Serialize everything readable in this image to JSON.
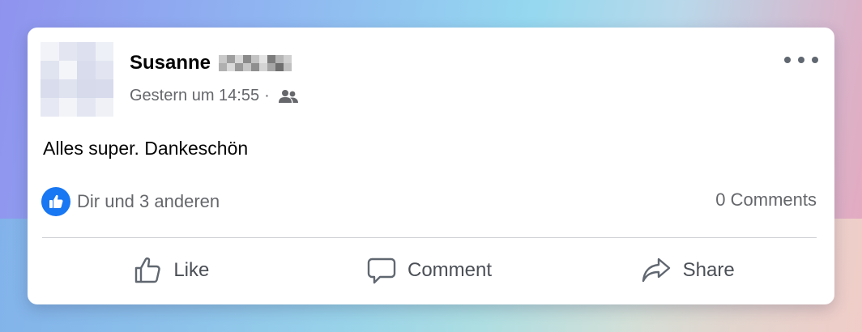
{
  "post": {
    "author_first_name": "Susanne",
    "timestamp": "Gestern um 14:55",
    "separator": "·",
    "audience_icon": "friends-icon",
    "text": "Alles super. Dankeschön",
    "reactions": {
      "icon": "like-reaction-icon",
      "summary": "Dir und 3 anderen"
    },
    "comments_count": "0 Comments",
    "more_icon": "more-options-icon"
  },
  "actions": {
    "like_label": "Like",
    "comment_label": "Comment",
    "share_label": "Share"
  },
  "colors": {
    "brand_blue": "#1877f2",
    "secondary_text": "#65676b",
    "primary_text": "#050505",
    "action_text": "#4b4f56"
  }
}
